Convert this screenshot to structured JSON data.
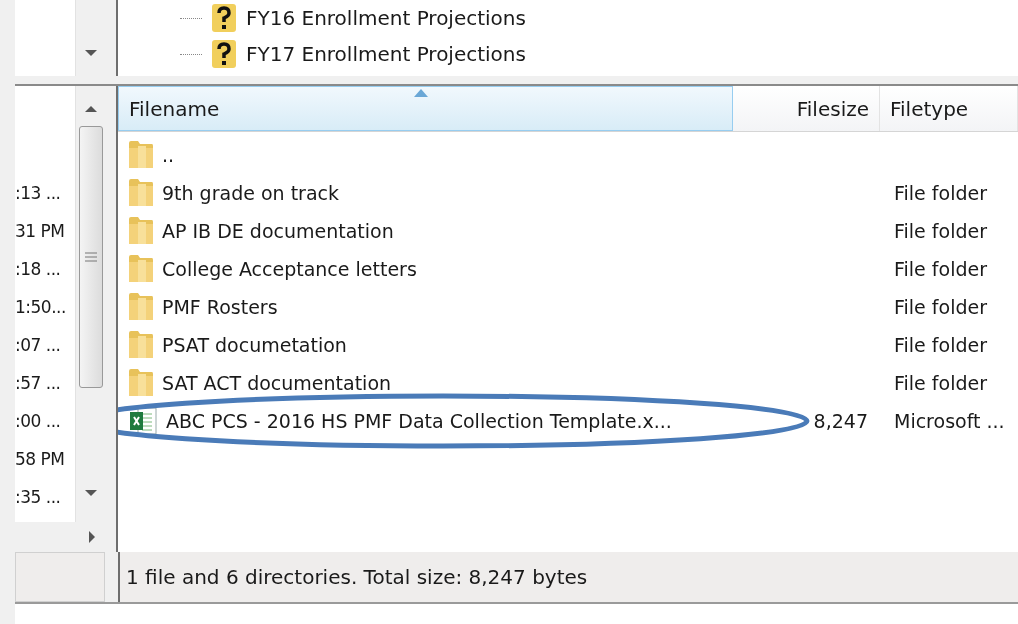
{
  "tree": {
    "items": [
      {
        "label": "FY16 Enrollment Projections"
      },
      {
        "label": "FY17 Enrollment Projections"
      }
    ]
  },
  "local_list": {
    "rows": [
      ":13 ...",
      "31 PM",
      ":18 ...",
      "1:50...",
      ":07 ...",
      ":57 ...",
      ":00 ...",
      "58 PM",
      ":35 ..."
    ]
  },
  "file_list": {
    "columns": [
      {
        "label": "Filename",
        "sorted": true
      },
      {
        "label": "Filesize",
        "sorted": false
      },
      {
        "label": "Filetype",
        "sorted": false
      }
    ],
    "rows": [
      {
        "kind": "folder",
        "name": "..",
        "size": "",
        "type": "",
        "circled": false
      },
      {
        "kind": "folder",
        "name": "9th grade on track",
        "type": "File folder",
        "circled": false
      },
      {
        "kind": "folder",
        "name": "AP IB DE documentation",
        "type": "File folder",
        "circled": false
      },
      {
        "kind": "folder",
        "name": "College Acceptance letters",
        "type": "File folder",
        "circled": false
      },
      {
        "kind": "folder",
        "name": "PMF Rosters",
        "type": "File folder",
        "circled": false
      },
      {
        "kind": "folder",
        "name": "PSAT documetation",
        "type": "File folder",
        "circled": false
      },
      {
        "kind": "folder",
        "name": "SAT ACT documentation",
        "type": "File folder",
        "circled": false
      },
      {
        "kind": "excel",
        "name": "ABC PCS - 2016 HS PMF Data Collection Template.x...",
        "size": "8,247",
        "type": "Microsoft ...",
        "circled": true
      }
    ]
  },
  "status_bar": {
    "text": "1 file and 6 directories. Total size: 8,247 bytes"
  }
}
